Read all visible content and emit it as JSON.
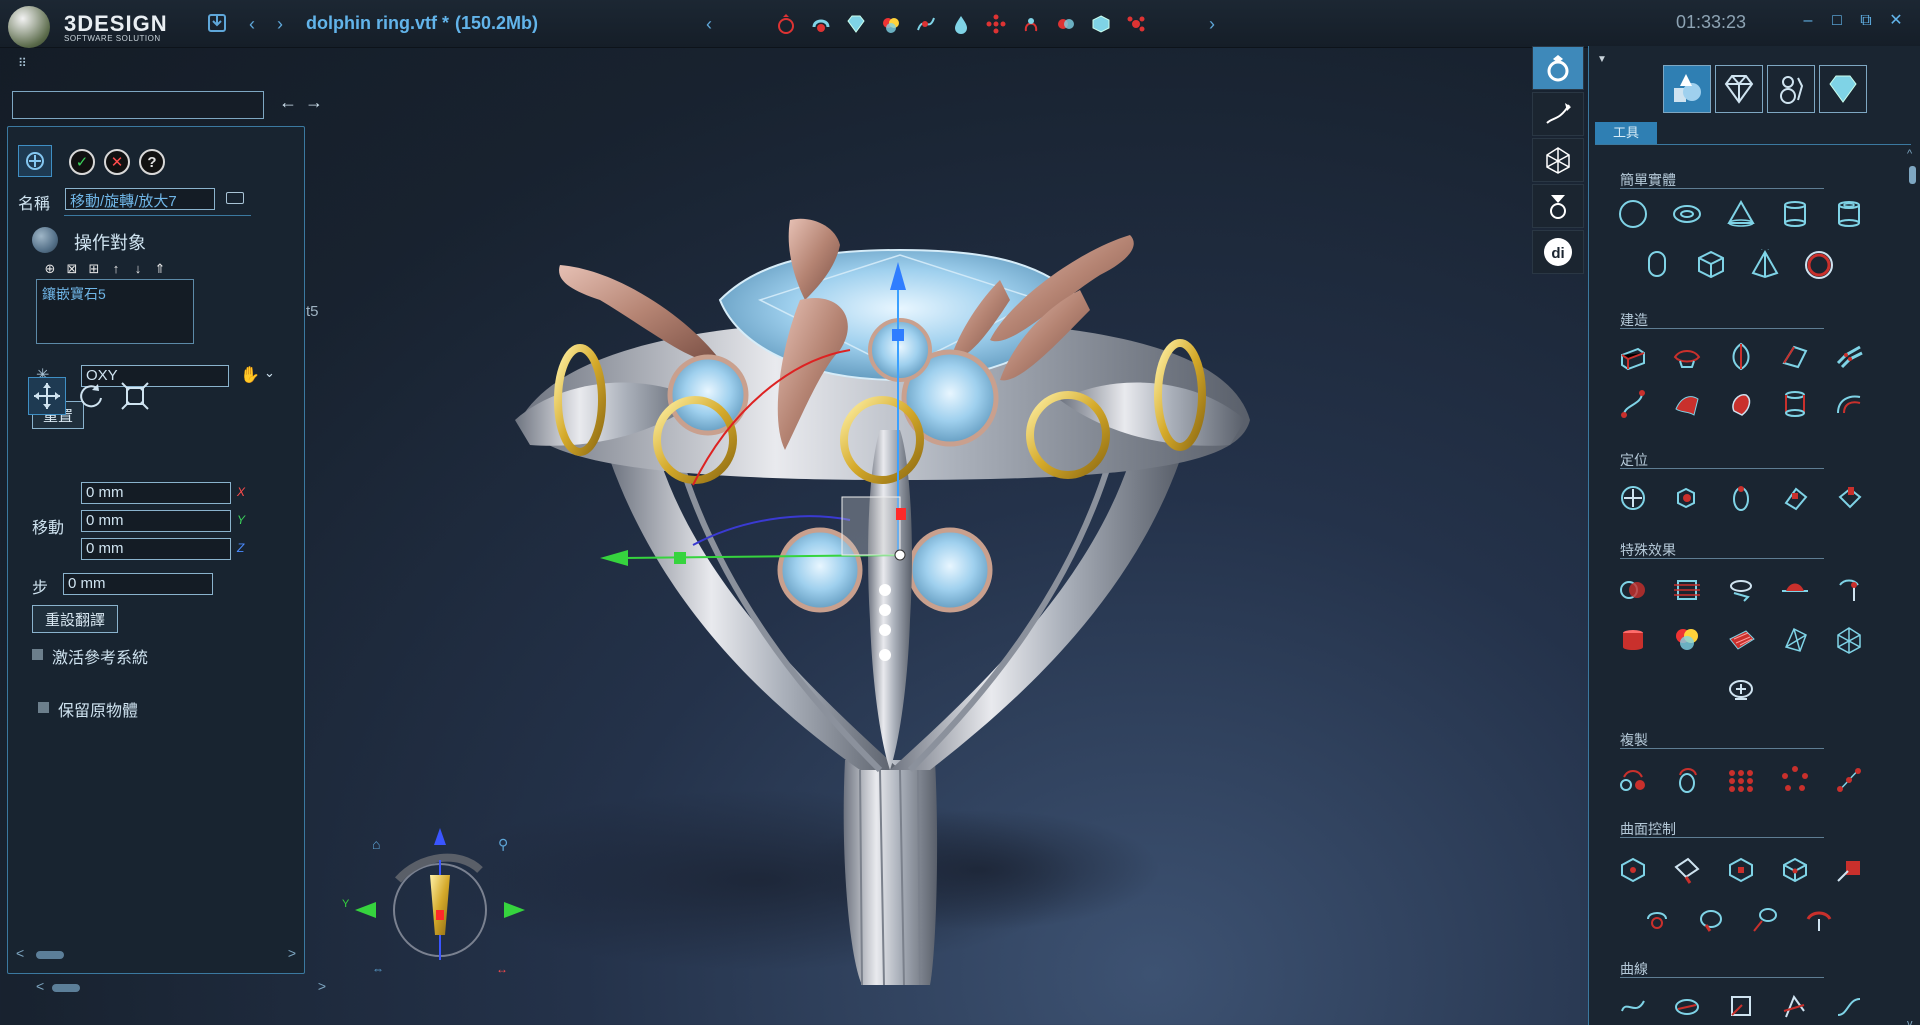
{
  "app": {
    "logo_text": "3DESIGN",
    "logo_sub": "SOFTWARE SOLUTION",
    "file_name": "dolphin ring.vtf *",
    "file_size": "(150.2Mb)",
    "time": "01:33:23"
  },
  "left_panel": {
    "name_label": "名稱",
    "name_value": "移動/旋轉/放大7",
    "objects_title": "操作對象",
    "objects": [
      "鑲嵌寶石5"
    ],
    "plane_value": "OXY",
    "reset_label": "重置",
    "move_label": "移動",
    "move_x": "0 mm",
    "move_y": "0 mm",
    "move_z": "0 mm",
    "axis_x": "X",
    "axis_y": "Y",
    "axis_z": "Z",
    "step_label": "步",
    "step_value": "0 mm",
    "reset_translate_label": "重設翻譯",
    "ref_system_label": "激活參考系統",
    "keep_original_label": "保留原物體"
  },
  "viewport": {
    "partial_label": "t5",
    "gizmo_y_label": "Y"
  },
  "right_panel": {
    "tab_label": "工具",
    "sections": {
      "simple_solids": "簡單實體",
      "build": "建造",
      "positioning": "定位",
      "special_effects": "特殊效果",
      "copy": "複製",
      "surface_control": "曲面控制",
      "curves": "曲線"
    }
  },
  "colors": {
    "accent": "#62b4ea",
    "panel_border": "#3b79a0",
    "active_tab": "#3e89ba",
    "icon_red": "#c9302c",
    "icon_cyan": "#7fd3e6"
  }
}
